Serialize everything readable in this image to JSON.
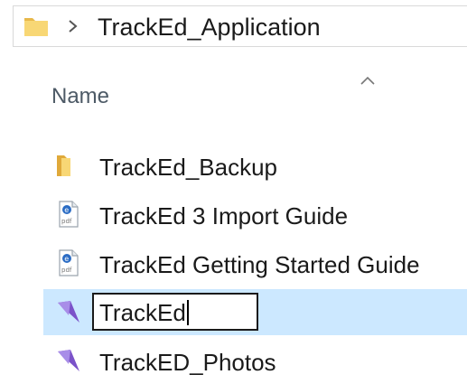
{
  "address_bar": {
    "path": "TrackEd_Application",
    "folder_icon": "folder-icon",
    "separator_icon": "chevron-right-icon"
  },
  "file_list": {
    "sort_indicator": "chevron-up-icon",
    "column_header": "Name",
    "items": [
      {
        "name": "TrackEd_Backup",
        "icon": "folder-icon",
        "selected": false
      },
      {
        "name": "TrackEd 3 Import Guide",
        "icon": "pdf-file-icon",
        "selected": false
      },
      {
        "name": "TrackEd Getting Started Guide",
        "icon": "pdf-file-icon",
        "selected": false
      },
      {
        "name": "TrackEd",
        "icon": "app-shortcut-icon",
        "selected": true,
        "renaming": true
      },
      {
        "name": "TrackED_Photos",
        "icon": "app-shortcut-icon",
        "selected": false
      }
    ]
  },
  "colors": {
    "selection": "#cce8ff",
    "folder": "#f8d775",
    "header_text": "#4d5a66"
  }
}
